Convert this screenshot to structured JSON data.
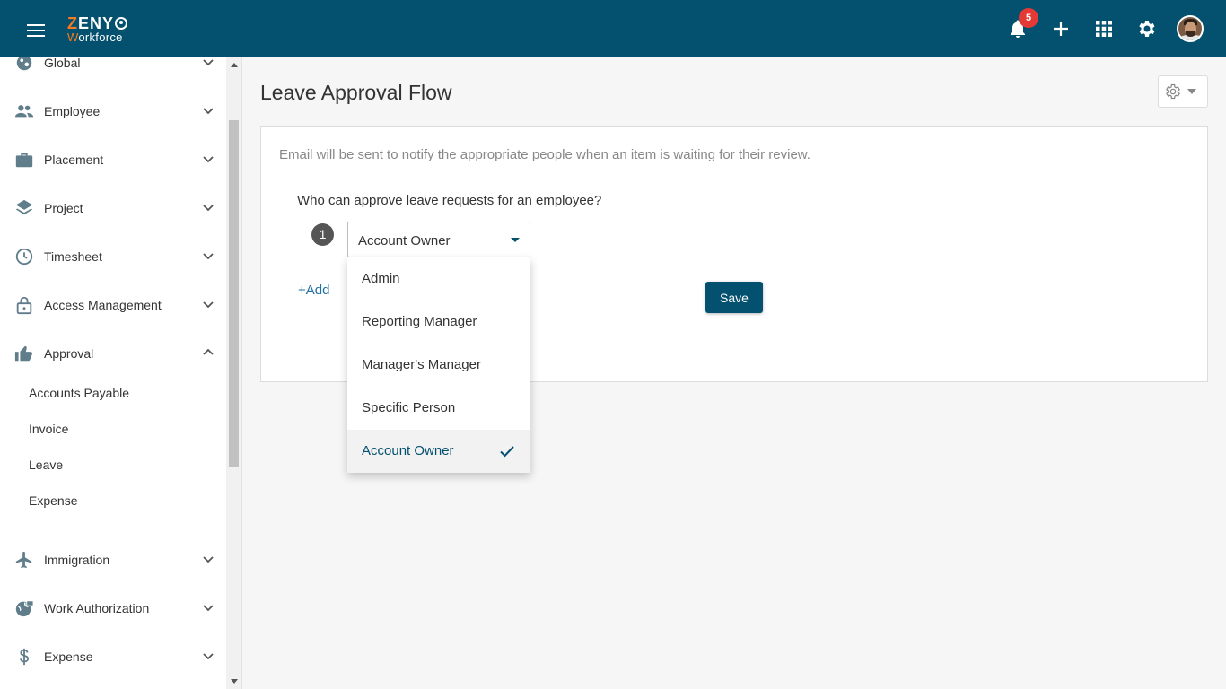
{
  "header": {
    "brand_main": "ZENY",
    "brand_sub": "Workforce",
    "notification_count": "5",
    "icons": [
      "menu-icon",
      "bell-icon",
      "plus-icon",
      "apps-grid-icon",
      "gear-icon",
      "avatar"
    ]
  },
  "sidebar": {
    "items": [
      {
        "label": "Global",
        "icon": "globe-icon",
        "expanded": false
      },
      {
        "label": "Employee",
        "icon": "people-icon",
        "expanded": false
      },
      {
        "label": "Placement",
        "icon": "briefcase-icon",
        "expanded": false
      },
      {
        "label": "Project",
        "icon": "layers-icon",
        "expanded": false
      },
      {
        "label": "Timesheet",
        "icon": "clock-icon",
        "expanded": false
      },
      {
        "label": "Access Management",
        "icon": "lock-icon",
        "expanded": false
      },
      {
        "label": "Approval",
        "icon": "thumbs-up-icon",
        "expanded": true
      },
      {
        "label": "Immigration",
        "icon": "airplane-icon",
        "expanded": false
      },
      {
        "label": "Work Authorization",
        "icon": "globe-lock-icon",
        "expanded": false
      },
      {
        "label": "Expense",
        "icon": "dollar-icon",
        "expanded": false
      }
    ],
    "approval_children": [
      "Accounts Payable",
      "Invoice",
      "Leave",
      "Expense"
    ]
  },
  "main": {
    "title": "Leave Approval Flow",
    "notice": "Email will be sent to notify the appropriate people when an item is waiting for their review.",
    "question": "Who can approve leave requests for an employee?",
    "step_number": "1",
    "selected_value": "Account Owner",
    "add_label": "+Add",
    "save_label": "Save"
  },
  "dropdown": {
    "options": [
      "Admin",
      "Reporting Manager",
      "Manager's Manager",
      "Specific Person",
      "Account Owner"
    ],
    "selected_index": 4
  },
  "colors": {
    "primary": "#03506f",
    "accent": "#f47b20",
    "badge": "#e53935",
    "link": "#1f6fa3"
  }
}
